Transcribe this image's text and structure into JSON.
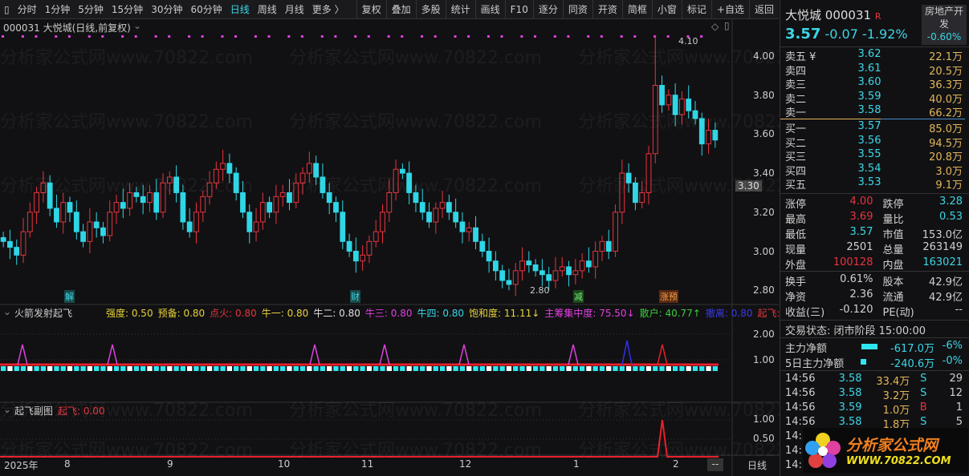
{
  "toolbar": {
    "periods": [
      "分时",
      "1分钟",
      "5分钟",
      "15分钟",
      "30分钟",
      "60分钟",
      "日线",
      "周线",
      "月线",
      "更多 〉"
    ],
    "active": "日线",
    "buttons": [
      "复权",
      "叠加",
      "多股",
      "统计",
      "画线",
      "F10",
      "逐分",
      "同资",
      "开资",
      "简框",
      "小窗",
      "标记",
      "+自选",
      "返回"
    ]
  },
  "chart": {
    "title": "000031 大悦城(日线,前复权)",
    "price_axis": [
      "4.00",
      "3.80",
      "3.60",
      "3.40",
      "3.20",
      "3.00",
      "2.80"
    ],
    "cursor_price": "3.30",
    "high_label": "4.10",
    "low_label": "2.80",
    "closes": [
      3.05,
      3.02,
      2.98,
      3.1,
      3.2,
      3.3,
      3.35,
      3.22,
      3.15,
      3.25,
      3.2,
      3.1,
      3.05,
      3.15,
      3.12,
      3.08,
      3.2,
      3.25,
      3.22,
      3.3,
      3.28,
      3.25,
      3.3,
      3.2,
      3.35,
      3.38,
      3.3,
      3.15,
      3.1,
      3.2,
      3.28,
      3.35,
      3.42,
      3.45,
      3.4,
      3.3,
      3.2,
      3.1,
      3.15,
      3.25,
      3.2,
      3.28,
      3.3,
      3.25,
      3.35,
      3.4,
      3.45,
      3.38,
      3.3,
      3.25,
      3.2,
      3.05,
      3.0,
      2.95,
      2.98,
      3.05,
      3.1,
      3.2,
      3.3,
      3.42,
      3.4,
      3.3,
      3.25,
      3.2,
      3.15,
      3.22,
      3.25,
      3.2,
      3.15,
      3.1,
      3.12,
      3.05,
      3.0,
      2.95,
      2.9,
      2.85,
      2.83,
      2.9,
      2.95,
      2.93,
      2.9,
      2.88,
      2.85,
      2.9,
      2.92,
      2.88,
      2.9,
      2.95,
      2.92,
      3.0,
      3.05,
      3.0,
      3.2,
      3.4,
      3.35,
      3.25,
      3.3,
      3.5,
      3.85,
      3.75,
      3.8,
      3.7,
      3.78,
      3.72,
      3.68,
      3.55,
      3.62,
      3.57
    ],
    "event_tags": [
      "解",
      "财",
      "减",
      "涨预"
    ],
    "up_color": "#e8333f",
    "down_color": "#2fd6e6"
  },
  "indicator1": {
    "name": "火箭发射起飞",
    "params": [
      {
        "k": "强度: ",
        "v": "0.50",
        "c": "#e6d23a"
      },
      {
        "k": "预备: ",
        "v": "0.80",
        "c": "#e6d23a"
      },
      {
        "k": "点火: ",
        "v": "0.80",
        "c": "#e8333f"
      },
      {
        "k": "牛一: ",
        "v": "0.80",
        "c": "#e6d23a"
      },
      {
        "k": "牛二: ",
        "v": "0.80",
        "c": "#e0e0e0"
      },
      {
        "k": "牛三: ",
        "v": "0.80",
        "c": "#e040e0"
      },
      {
        "k": "牛四: ",
        "v": "0.80",
        "c": "#3cd6e6"
      },
      {
        "k": "饱和度: ",
        "v": "11.11↓",
        "c": "#e6d23a"
      },
      {
        "k": "主筹集中度: ",
        "v": "75.50↓",
        "c": "#e040e0"
      },
      {
        "k": "散户: ",
        "v": "40.77↑",
        "c": "#3ccc3c"
      },
      {
        "k": "撤离: ",
        "v": "0.80",
        "c": "#3a3ae8"
      },
      {
        "k": "起飞:",
        "v": "",
        "c": "#e8333f"
      }
    ],
    "axis": [
      "2.00",
      "1.00"
    ]
  },
  "indicator2": {
    "name": "起飞副图",
    "param_key": "起飞: ",
    "param_val": "0.00",
    "axis": [
      "1.00",
      "0.50"
    ]
  },
  "date_axis": {
    "labels": [
      "2025年",
      "8",
      "9",
      "10",
      "11",
      "12",
      "1",
      "2"
    ],
    "end": "--",
    "period": "日线"
  },
  "watermark": "分析家公式网www.70822.com",
  "quote": {
    "name": "大悦城",
    "code": "000031",
    "badge": "R",
    "price": "3.57",
    "change": "-0.07",
    "pct": "-1.92%",
    "sector": "房地产开发",
    "sector_pct": "-0.60%",
    "asks": [
      {
        "l": "卖五 ¥",
        "p": "3.62",
        "v": "22.1万"
      },
      {
        "l": "卖四",
        "p": "3.61",
        "v": "20.5万"
      },
      {
        "l": "卖三",
        "p": "3.60",
        "v": "36.3万"
      },
      {
        "l": "卖二",
        "p": "3.59",
        "v": "40.0万"
      },
      {
        "l": "卖一",
        "p": "3.58",
        "v": "66.2万"
      }
    ],
    "bids": [
      {
        "l": "买一",
        "p": "3.57",
        "v": "85.0万"
      },
      {
        "l": "买二",
        "p": "3.56",
        "v": "94.5万"
      },
      {
        "l": "买三",
        "p": "3.55",
        "v": "20.8万"
      },
      {
        "l": "买四",
        "p": "3.54",
        "v": "3.0万"
      },
      {
        "l": "买五",
        "p": "3.53",
        "v": "9.1万"
      }
    ],
    "stats": [
      [
        "涨停",
        "4.00",
        "rd",
        "跌停",
        "3.28",
        "cy"
      ],
      [
        "最高",
        "3.69",
        "rd",
        "量比",
        "0.53",
        "cy"
      ],
      [
        "最低",
        "3.57",
        "cy",
        "市值",
        "153.0亿",
        "wh"
      ],
      [
        "现量",
        "2501",
        "wh",
        "总量",
        "263149",
        "wh"
      ],
      [
        "外盘",
        "100128",
        "rd",
        "内盘",
        "163021",
        "cy"
      ]
    ],
    "stats2": [
      [
        "换手",
        "0.61%",
        "股本",
        "42.9亿"
      ],
      [
        "净资",
        "2.36",
        "流通",
        "42.9亿"
      ],
      [
        "收益(三)",
        "-0.120",
        "PE(动)",
        "--"
      ]
    ],
    "status": "交易状态: 闭市阶段 15:00:00",
    "flows": [
      {
        "l": "主力净额",
        "v": "-617.0万",
        "p": "-6%"
      },
      {
        "l": "5日主力净额",
        "v": "-240.6万",
        "p": "-0%"
      }
    ],
    "ticks": [
      [
        "14:56",
        "3.58",
        "33.4万",
        "S",
        "29"
      ],
      [
        "14:56",
        "3.58",
        "3.2万",
        "S",
        "12"
      ],
      [
        "14:56",
        "3.59",
        "1.0万",
        "B",
        "1"
      ],
      [
        "14:56",
        "3.58",
        "1.8万",
        "S",
        "5"
      ],
      [
        "14:56",
        "",
        "",
        "",
        ""
      ],
      [
        "14:56",
        "",
        "",
        "",
        ""
      ],
      [
        "14:56",
        "",
        "",
        "",
        ""
      ]
    ]
  },
  "logo": {
    "text": "分析家公式网",
    "url": "WWW.70822.COM"
  }
}
